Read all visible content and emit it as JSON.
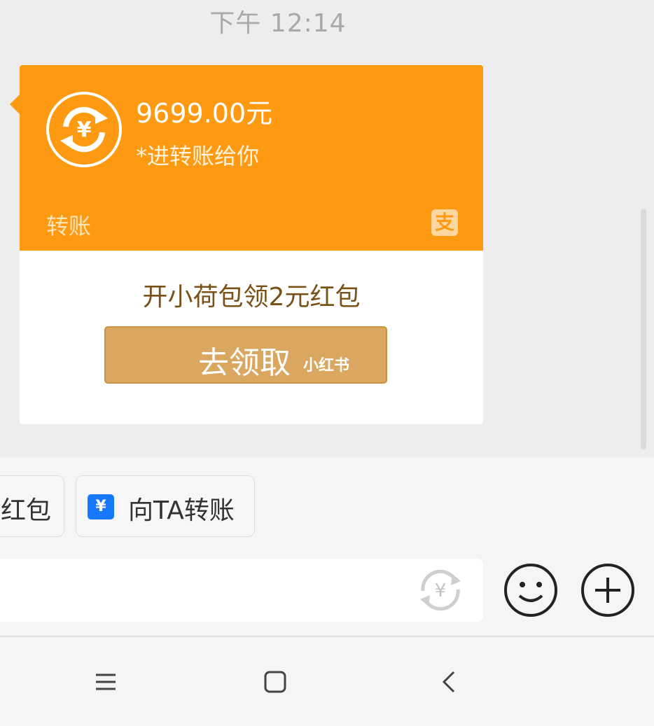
{
  "status": {
    "time": "下午 12:14"
  },
  "transfer_card": {
    "amount": "9699.00元",
    "note": "*进转账给你",
    "type_label": "转账",
    "alipay_logo_text": "支",
    "promo_text": "开小荷包领2元红包",
    "claim_button_label": "去领取",
    "watermark": "小红书",
    "colors": {
      "top": "#fd9a12",
      "button": "#d9a760"
    }
  },
  "quick_actions": [
    {
      "label": "红包"
    },
    {
      "label": "向TA转账",
      "icon": "yen-icon",
      "icon_text": "¥"
    }
  ],
  "input_bar": {
    "value": "",
    "placeholder": "",
    "icons": [
      "yen-exchange-icon",
      "emoji-icon",
      "plus-icon"
    ]
  },
  "nav_bar": {
    "buttons": [
      "menu-icon",
      "home-icon",
      "back-icon"
    ]
  }
}
